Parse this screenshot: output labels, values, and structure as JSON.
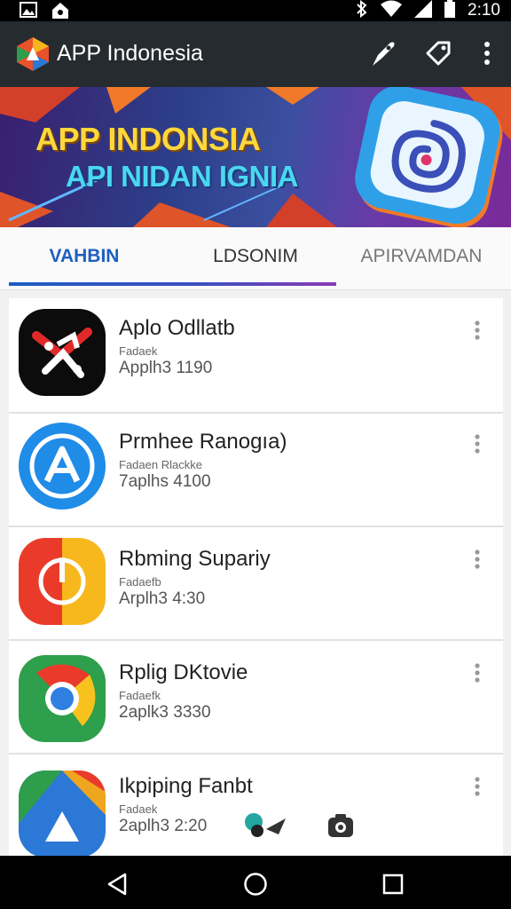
{
  "status_bar": {
    "time": "2:10",
    "left_icons": [
      "image-icon",
      "home-notification-icon"
    ],
    "right_icons": [
      "bluetooth-icon",
      "wifi-icon",
      "signal-icon",
      "battery-icon"
    ]
  },
  "app_bar": {
    "title": "APP Indonesia",
    "logo_icon": "app-logo-icon",
    "actions": [
      "pen-icon",
      "tag-icon",
      "more-vert-icon"
    ]
  },
  "banner": {
    "line1": "APP INDONSIA",
    "line2": "API NIDAN IGNIA"
  },
  "tabs": [
    {
      "label": "VAHBIN",
      "active": true
    },
    {
      "label": "LDSONIM",
      "active": false
    },
    {
      "label": "APIRVAMDAN",
      "active": false
    }
  ],
  "apps": [
    {
      "name": "Aplo Odllatb",
      "sub": "Fadaek",
      "meta": "Applh3 1190",
      "icon": "red-figure-icon"
    },
    {
      "name": "Prmhee Ranogıa)",
      "sub": "Fadaen Rlackke",
      "meta": "7aplhs 4100",
      "icon": "blue-a-icon"
    },
    {
      "name": "Rbming Supariy",
      "sub": "Fadaefb",
      "meta": "Arplh3 4:30",
      "icon": "power-icon"
    },
    {
      "name": "Rplig DKtovie",
      "sub": "Fadaefk",
      "meta": "2aplk3 3330",
      "icon": "chrome-icon"
    },
    {
      "name": "Ikpiping Fanbt",
      "sub": "Fadaek",
      "meta": "2aplh3 2:20",
      "icon": "colorful-triangle-icon"
    }
  ],
  "colors": {
    "app_bar": "#252b2f",
    "accent": "#1f5fbf",
    "banner_yellow": "#ffd83a",
    "banner_cyan": "#4ad8f0"
  },
  "nav_bar": [
    "back-icon",
    "home-icon",
    "recents-icon"
  ]
}
